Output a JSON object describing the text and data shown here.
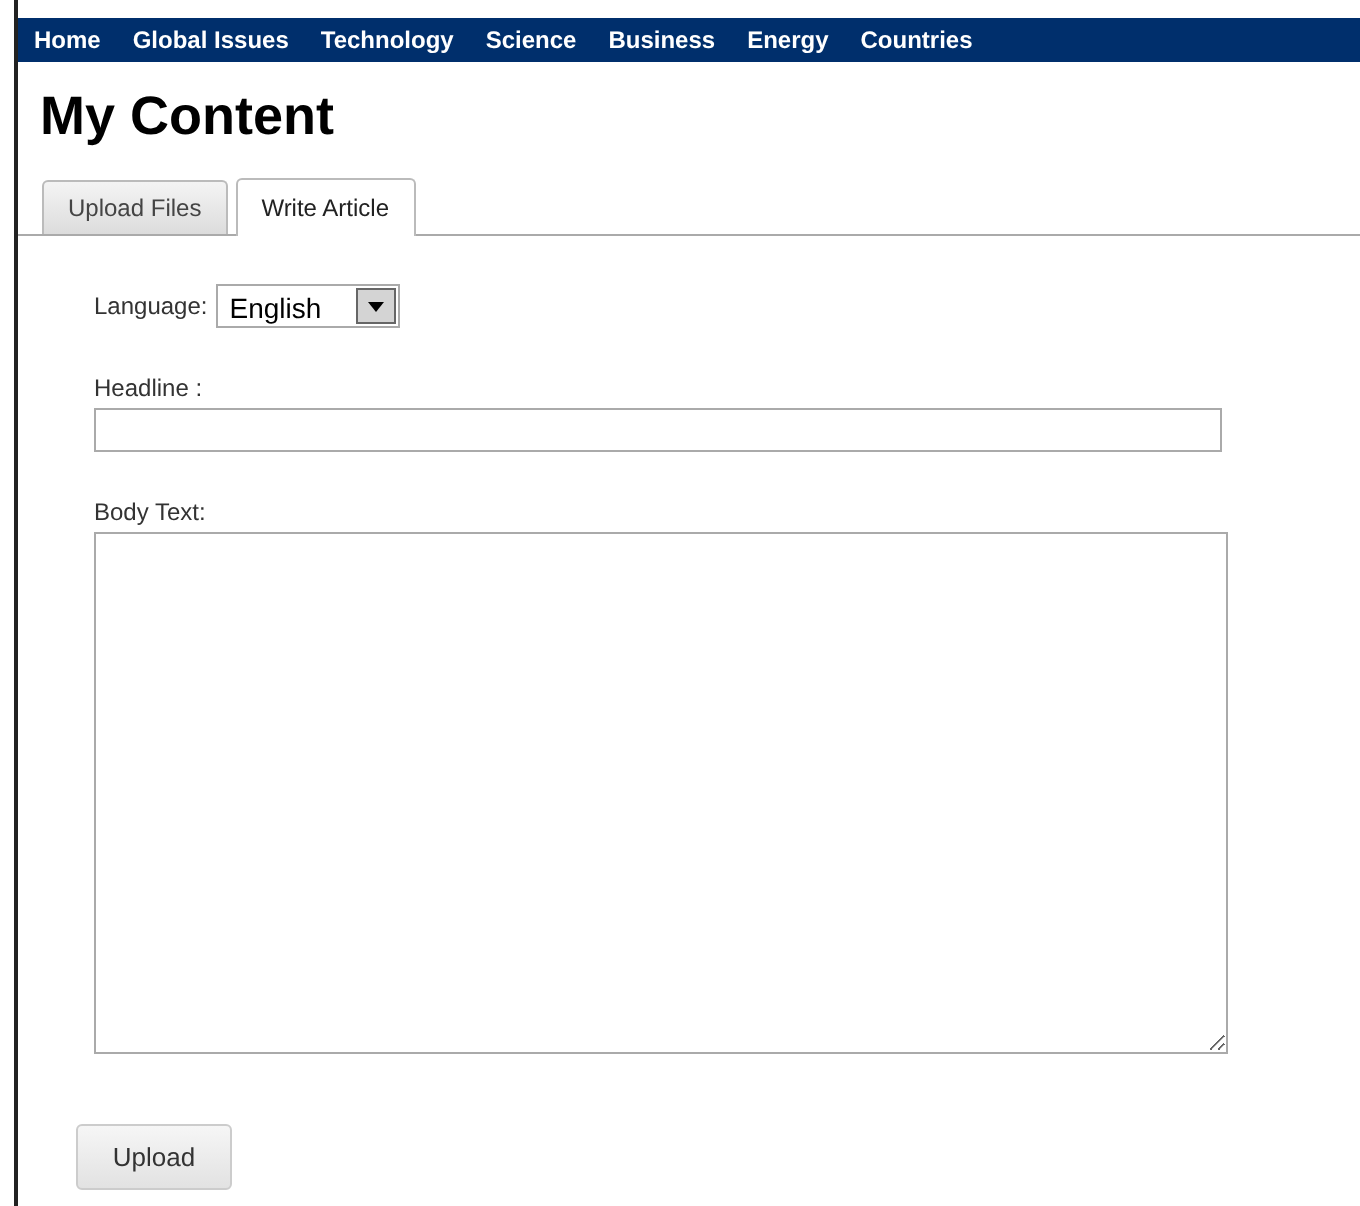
{
  "nav": {
    "items": [
      {
        "label": "Home"
      },
      {
        "label": "Global Issues"
      },
      {
        "label": "Technology"
      },
      {
        "label": "Science"
      },
      {
        "label": "Business"
      },
      {
        "label": "Energy"
      },
      {
        "label": "Countries"
      }
    ]
  },
  "title": "My Content",
  "tabs": [
    {
      "label": "Upload Files",
      "selected": false
    },
    {
      "label": "Write Article",
      "selected": true
    }
  ],
  "form": {
    "language_label": "Language:",
    "language_value": "English",
    "headline_label": "Headline :",
    "body_label": "Body Text:",
    "submit": "Upload"
  }
}
